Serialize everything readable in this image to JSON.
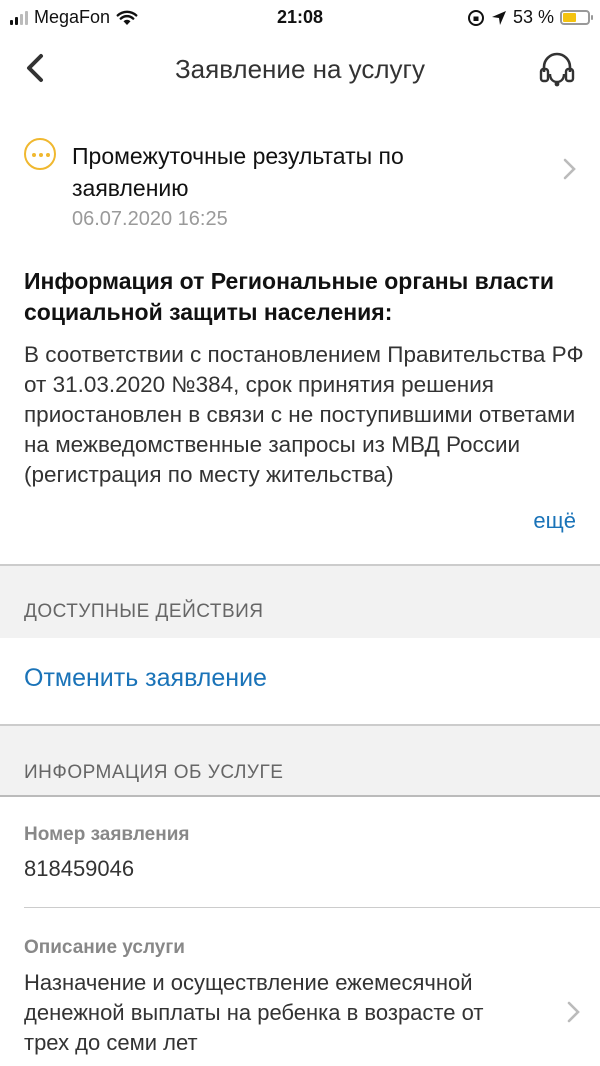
{
  "status_bar": {
    "carrier": "MegaFon",
    "time": "21:08",
    "battery": "53 %"
  },
  "nav": {
    "title": "Заявление на услугу"
  },
  "status": {
    "title": "Промежуточные результаты по заявлению",
    "date": "06.07.2020 16:25",
    "color": "#f0b82f"
  },
  "info": {
    "heading": "Информация от Региональные органы власти социальной защиты населения:",
    "body": "В соответствии с постановлением Правительства РФ от 31.03.2020 №384, срок принятия решения приостановлен в связи с не поступившими ответами на межведомственные запросы из МВД России (регистрация по месту жительства)",
    "more_label": "ещё"
  },
  "actions": {
    "section_label": "ДОСТУПНЫЕ ДЕЙСТВИЯ",
    "cancel_label": "Отменить заявление"
  },
  "service_info": {
    "section_label": "ИНФОРМАЦИЯ ОБ УСЛУГЕ",
    "number_label": "Номер заявления",
    "number_value": "818459046",
    "description_label": "Описание услуги",
    "description_value": "Назначение и осуществление ежемесячной денежной выплаты на ребенка в возрасте от трех до семи лет"
  },
  "colors": {
    "link": "#1a73b8",
    "accent": "#f0b82f"
  }
}
